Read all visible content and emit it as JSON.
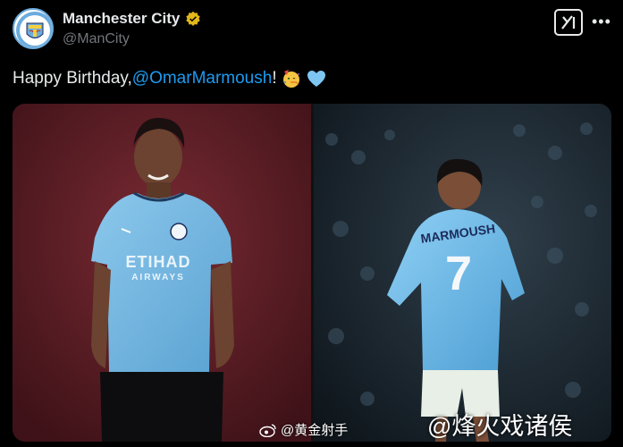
{
  "account": {
    "name": "Manchester City",
    "handle": "@ManCity",
    "verified_color": "#e2b719"
  },
  "tweet": {
    "text_before": "Happy Birthday, ",
    "mention": "@OmarMarmoush",
    "text_after": "!",
    "emojis": [
      "party-face-emoji",
      "light-blue-heart-emoji"
    ]
  },
  "photos": [
    {
      "description": "player-portrait",
      "shirt_sponsor": "ETIHAD AIRWAYS"
    },
    {
      "description": "player-back-on-pitch",
      "shirt_name": "MARMOUSH",
      "shirt_number": "7"
    }
  ],
  "watermarks": {
    "weibo_user": "@黄金射手",
    "overlay": "@烽火戏诸侯"
  },
  "colors": {
    "background": "#000000",
    "mention": "#1d9bf0",
    "city_blue": "#6cabdd"
  }
}
